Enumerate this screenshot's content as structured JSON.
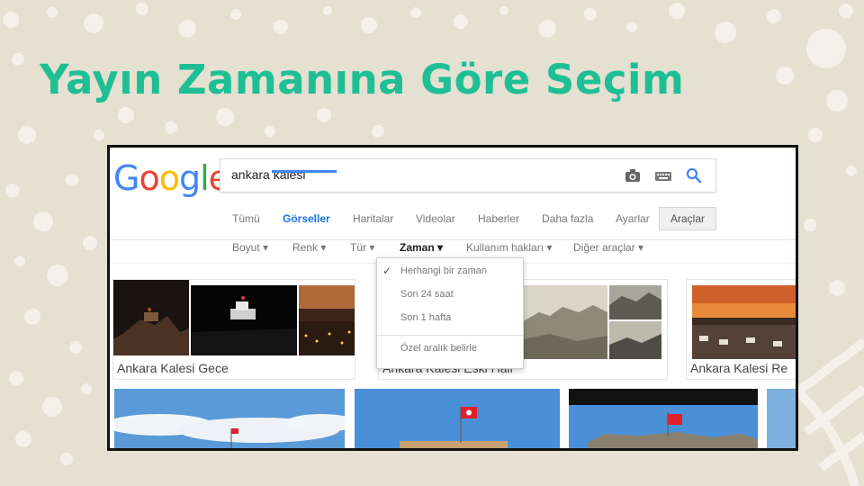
{
  "slide": {
    "title": "Yayın Zamanına Göre Seçim"
  },
  "google": {
    "logo": {
      "letters": [
        "G",
        "o",
        "o",
        "g",
        "l",
        "e"
      ]
    },
    "search": {
      "query": "ankara kalesi",
      "icons": [
        "camera-icon",
        "keyboard-icon",
        "search-icon"
      ]
    },
    "tabs": [
      "Tümü",
      "Görseller",
      "Haritalar",
      "Videolar",
      "Haberler",
      "Daha fazla",
      "Ayarlar"
    ],
    "active_tab": "Görseller",
    "tools_label": "Araçlar",
    "filters": [
      "Boyut ▾",
      "Renk ▾",
      "Tür ▾",
      "Zaman ▾",
      "Kullanım hakları ▾",
      "Diğer araçlar ▾"
    ],
    "active_filter": "Zaman ▾",
    "time_menu": {
      "selected_mark": "✓",
      "items": [
        "Herhangi bir zaman",
        "Son 24 saat",
        "Son 1 hafta",
        "Özel aralık belirle"
      ]
    },
    "image_groups": [
      "Ankara Kalesi Gece",
      "Ankara Kalesi Eski Hali",
      "Ankara Kalesi Re"
    ]
  },
  "colors": {
    "title": "#1fbf95",
    "background": "#e4e0d2",
    "accent_blue": "#4285f4"
  }
}
